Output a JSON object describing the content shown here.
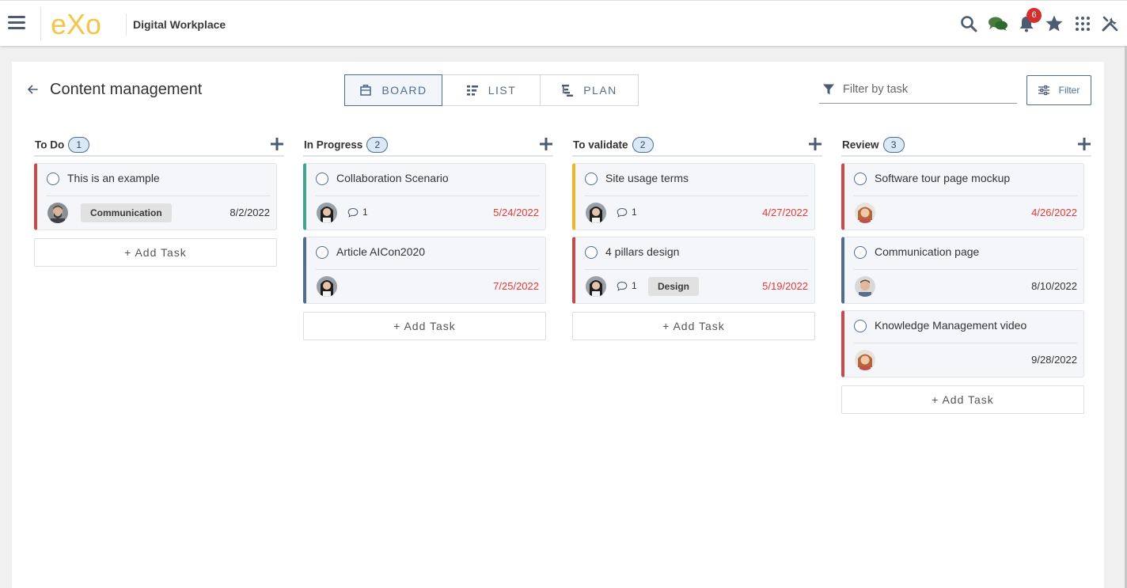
{
  "app": {
    "brand_title": "Digital Workplace",
    "logo_text": "eXo",
    "notification_count": "6",
    "accent_color": "#4e6d91"
  },
  "page": {
    "title": "Content management",
    "views": [
      {
        "label": "BOARD",
        "icon": "board-icon",
        "active": true
      },
      {
        "label": "LIST",
        "icon": "list-icon",
        "active": false
      },
      {
        "label": "PLAN",
        "icon": "plan-icon",
        "active": false
      }
    ],
    "filter_placeholder": "Filter by task",
    "filter_button": "Filter",
    "add_task_label": "+ Add Task"
  },
  "columns": [
    {
      "title": "To Do",
      "count": "1",
      "cards": [
        {
          "title": "This is an example",
          "color": "#c94a4a",
          "avatar": "man-beard",
          "comments": "",
          "tag": "Communication",
          "date": "8/2/2022",
          "overdue": false
        }
      ]
    },
    {
      "title": "In Progress",
      "count": "2",
      "cards": [
        {
          "title": "Collaboration Scenario",
          "color": "#3fa58c",
          "avatar": "woman-dark",
          "comments": "1",
          "tag": "",
          "date": "5/24/2022",
          "overdue": true
        },
        {
          "title": "Article AICon2020",
          "color": "#4e6d91",
          "avatar": "woman-dark",
          "comments": "",
          "tag": "",
          "date": "7/25/2022",
          "overdue": true
        }
      ]
    },
    {
      "title": "To validate",
      "count": "2",
      "cards": [
        {
          "title": "Site usage terms",
          "color": "#f0b429",
          "avatar": "woman-dark",
          "comments": "1",
          "tag": "",
          "date": "4/27/2022",
          "overdue": true
        },
        {
          "title": "4 pillars design",
          "color": "#c94a4a",
          "avatar": "woman-dark",
          "comments": "1",
          "tag": "Design",
          "date": "5/19/2022",
          "overdue": true
        }
      ]
    },
    {
      "title": "Review",
      "count": "3",
      "cards": [
        {
          "title": "Software tour page mockup",
          "color": "#c94a4a",
          "avatar": "woman-red",
          "comments": "",
          "tag": "",
          "date": "4/26/2022",
          "overdue": true
        },
        {
          "title": "Communication page",
          "color": "#4e6d91",
          "avatar": "man-smile",
          "comments": "",
          "tag": "",
          "date": "8/10/2022",
          "overdue": false
        },
        {
          "title": "Knowledge Management video",
          "color": "#c94a4a",
          "avatar": "woman-red",
          "comments": "",
          "tag": "",
          "date": "9/28/2022",
          "overdue": false
        }
      ]
    }
  ]
}
